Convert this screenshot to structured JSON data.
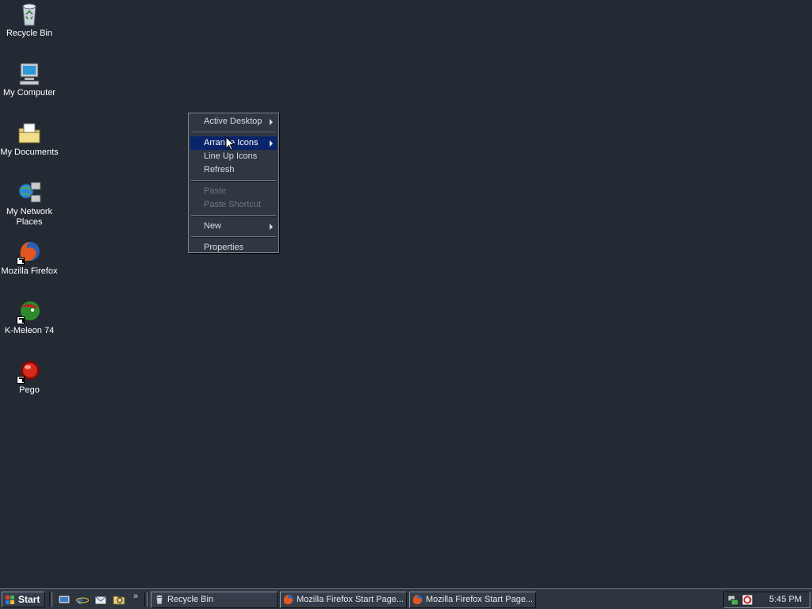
{
  "desktop": {
    "icons": [
      {
        "label": "Recycle Bin",
        "icon": "recycle-bin-icon"
      },
      {
        "label": "My Computer",
        "icon": "my-computer-icon"
      },
      {
        "label": "My Documents",
        "icon": "my-documents-icon"
      },
      {
        "label": "My Network Places",
        "icon": "network-places-icon"
      },
      {
        "label": "Mozilla Firefox",
        "icon": "firefox-icon"
      },
      {
        "label": "K-Meleon 74",
        "icon": "k-meleon-icon"
      },
      {
        "label": "Pego",
        "icon": "pego-icon"
      }
    ]
  },
  "context_menu": {
    "items": [
      {
        "label": "Active Desktop",
        "submenu": true,
        "disabled": false
      },
      {
        "label": "Arrange Icons",
        "submenu": true,
        "disabled": false,
        "highlighted": true
      },
      {
        "label": "Line Up Icons",
        "submenu": false,
        "disabled": false
      },
      {
        "label": "Refresh",
        "submenu": false,
        "disabled": false
      },
      {
        "label": "Paste",
        "submenu": false,
        "disabled": true
      },
      {
        "label": "Paste Shortcut",
        "submenu": false,
        "disabled": true
      },
      {
        "label": "New",
        "submenu": true,
        "disabled": false
      },
      {
        "label": "Properties",
        "submenu": false,
        "disabled": false
      }
    ]
  },
  "taskbar": {
    "start_label": "Start",
    "quick_launch": [
      "show-desktop-icon",
      "internet-explorer-icon",
      "outlook-icon",
      "explorer-icon"
    ],
    "chevron": "»",
    "tasks": [
      {
        "label": "Recycle Bin",
        "icon": "recycle-bin-icon"
      },
      {
        "label": "Mozilla Firefox Start Page...",
        "icon": "firefox-icon"
      },
      {
        "label": "Mozilla Firefox Start Page...",
        "icon": "firefox-icon"
      }
    ],
    "tray": {
      "icons": [
        "network-icon",
        "antivirus-icon"
      ],
      "clock": "5:45 PM"
    }
  },
  "colors": {
    "desktop": "#232a33",
    "menu_highlight": "#0a246a",
    "taskbar": "#2d3540"
  }
}
